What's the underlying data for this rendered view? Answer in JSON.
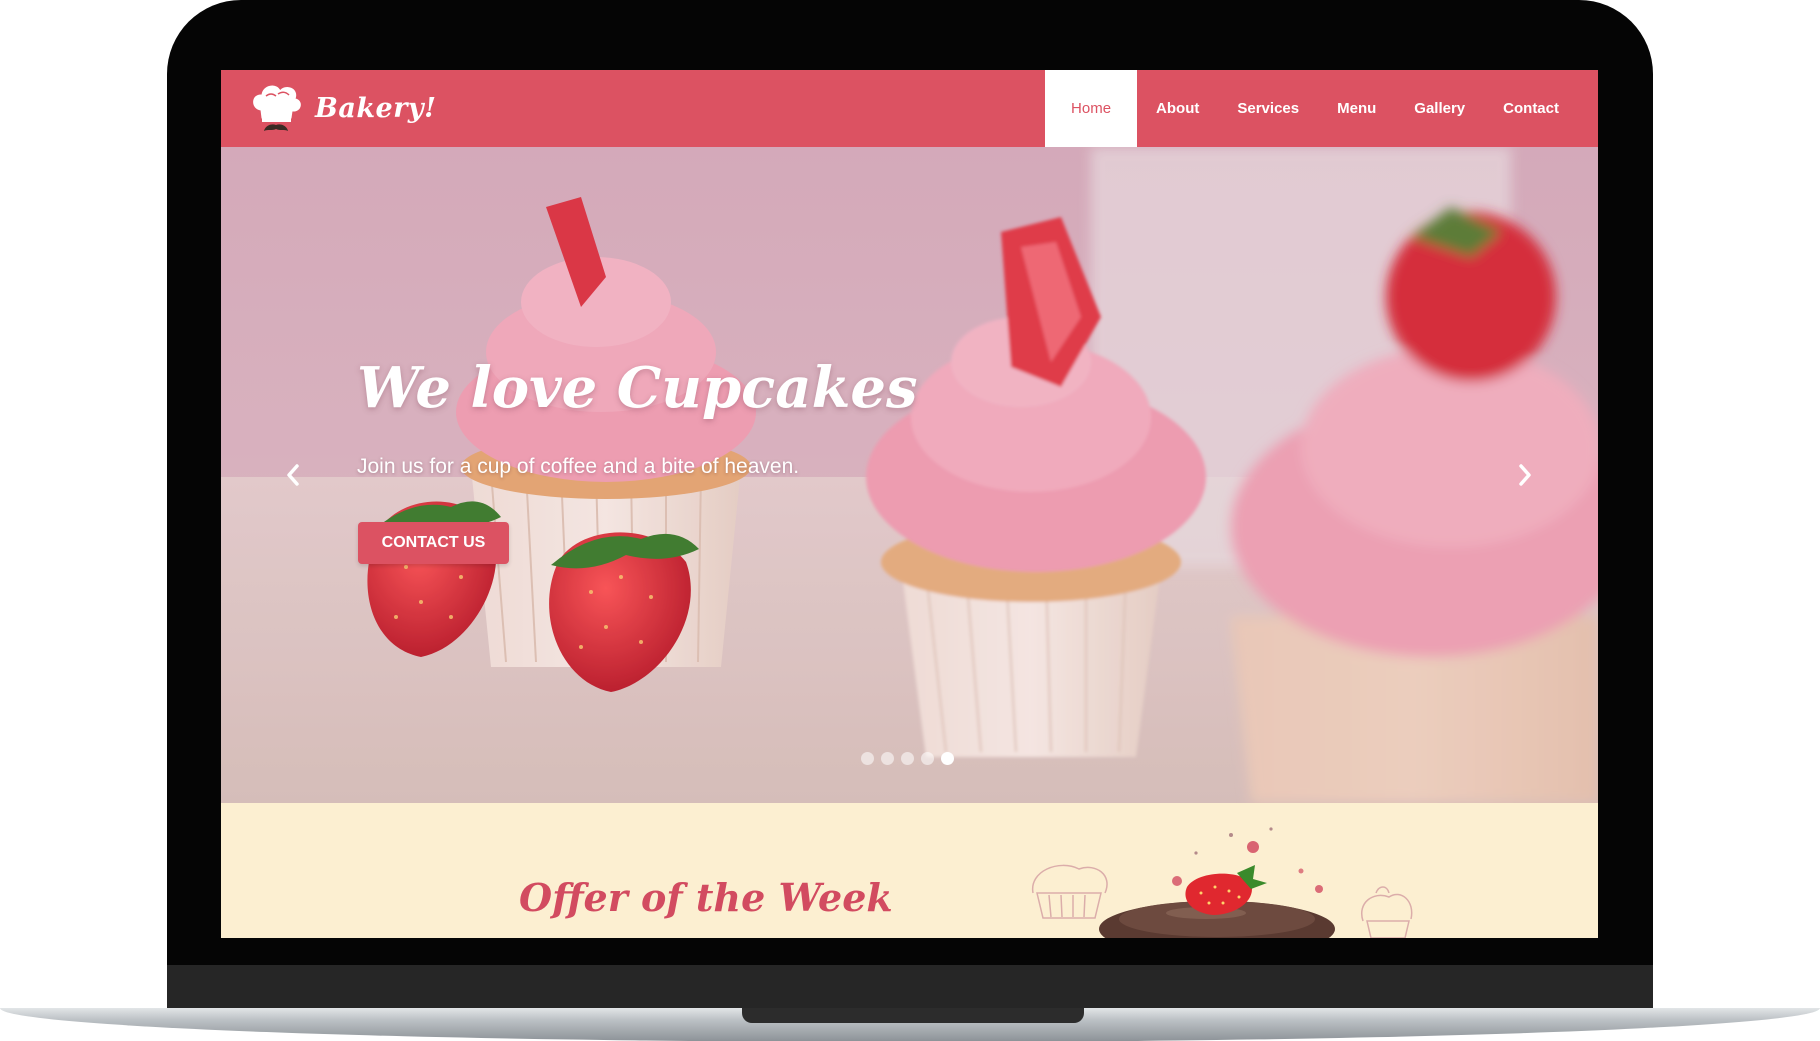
{
  "brand": {
    "name": "Bakery!",
    "logo_icon": "chef-hat-mustache-icon"
  },
  "nav": {
    "items": [
      {
        "label": "Home",
        "active": true
      },
      {
        "label": "About",
        "active": false
      },
      {
        "label": "Services",
        "active": false
      },
      {
        "label": "Menu",
        "active": false
      },
      {
        "label": "Gallery",
        "active": false
      },
      {
        "label": "Contact",
        "active": false
      }
    ]
  },
  "hero": {
    "title": "We love Cupcakes",
    "subtitle": "Join us for a cup of coffee and a bite of heaven.",
    "button_label": "CONTACT US",
    "prev_icon": "chevron-left-icon",
    "next_icon": "chevron-right-icon",
    "slide_count": 5,
    "active_slide": 5
  },
  "offer": {
    "title": "Offer of the Week"
  },
  "colors": {
    "brand": "#dc5262",
    "offer_bg": "#fcefd1",
    "offer_title": "#d24b60",
    "frame": "#050505"
  }
}
